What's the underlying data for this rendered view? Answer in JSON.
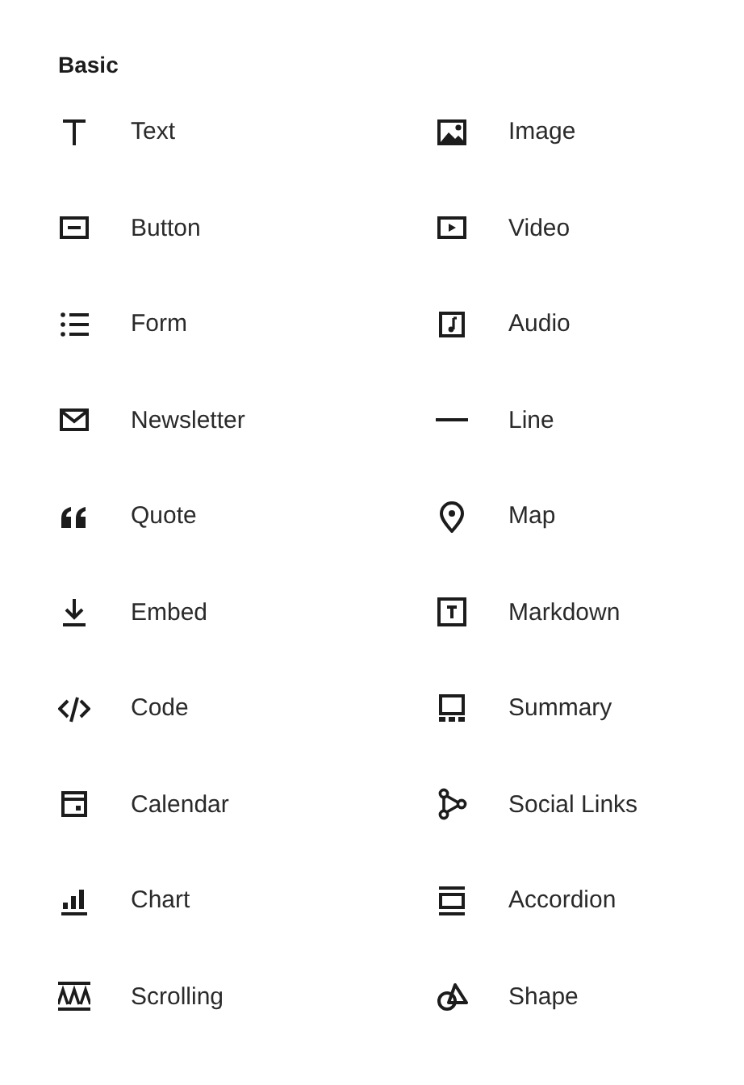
{
  "section": {
    "title": "Basic"
  },
  "blocks": [
    {
      "label": "Text",
      "kind": "text"
    },
    {
      "label": "Image",
      "kind": "image"
    },
    {
      "label": "Button",
      "kind": "button"
    },
    {
      "label": "Video",
      "kind": "video"
    },
    {
      "label": "Form",
      "kind": "form"
    },
    {
      "label": "Audio",
      "kind": "audio"
    },
    {
      "label": "Newsletter",
      "kind": "newsletter"
    },
    {
      "label": "Line",
      "kind": "line"
    },
    {
      "label": "Quote",
      "kind": "quote"
    },
    {
      "label": "Map",
      "kind": "map"
    },
    {
      "label": "Embed",
      "kind": "embed"
    },
    {
      "label": "Markdown",
      "kind": "markdown"
    },
    {
      "label": "Code",
      "kind": "code"
    },
    {
      "label": "Summary",
      "kind": "summary"
    },
    {
      "label": "Calendar",
      "kind": "calendar"
    },
    {
      "label": "Social Links",
      "kind": "social"
    },
    {
      "label": "Chart",
      "kind": "chart"
    },
    {
      "label": "Accordion",
      "kind": "accordion"
    },
    {
      "label": "Scrolling",
      "kind": "scrolling"
    },
    {
      "label": "Shape",
      "kind": "shape"
    }
  ]
}
